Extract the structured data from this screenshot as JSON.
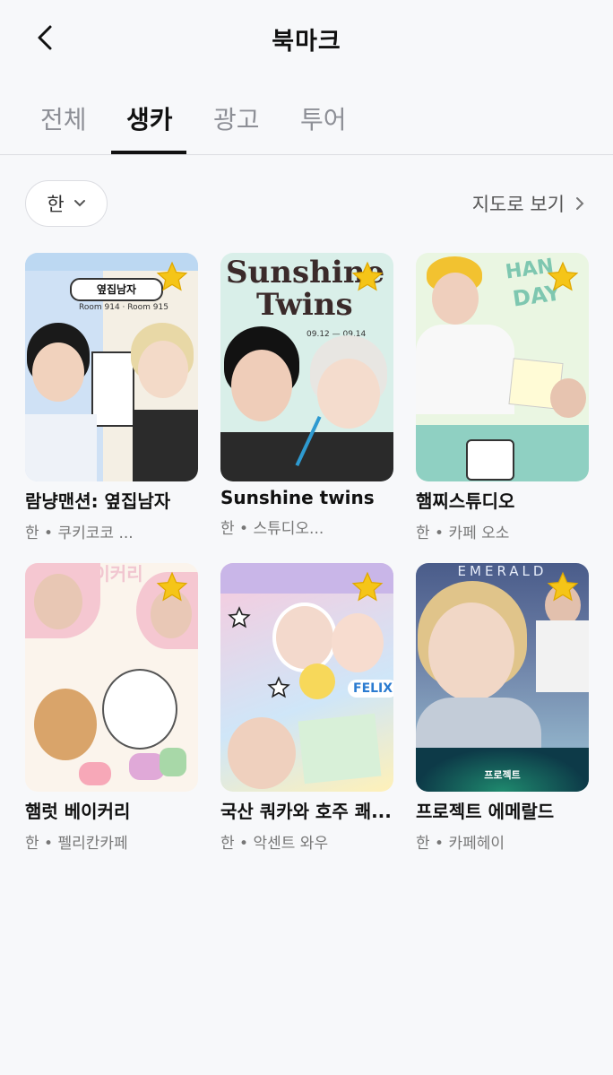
{
  "header": {
    "title": "북마크"
  },
  "tabs": [
    {
      "label": "전체"
    },
    {
      "label": "생카",
      "active": true
    },
    {
      "label": "광고"
    },
    {
      "label": "투어"
    }
  ],
  "filter": {
    "selected": "한"
  },
  "map_link": {
    "label": "지도로 보기"
  },
  "cards": [
    {
      "title": "람냥맨션: 옆집남자",
      "subtitle": "한 • 쿠키코코 ...",
      "art_text": [
        "옆집남자",
        "Room 914 · Room 915"
      ]
    },
    {
      "title": "Sunshine twins",
      "subtitle": "한 • 스튜디오...",
      "art_text": [
        "Sunshine",
        "Twins",
        "09.12 — 09.14"
      ]
    },
    {
      "title": "햄찌스튜디오",
      "subtitle": "한 • 카페 오소",
      "art_text": [
        "HAN",
        "DAY"
      ]
    },
    {
      "title": "햄럿 베이커리",
      "subtitle": "한 • 펠리칸카페",
      "art_text": [
        "베이커리"
      ]
    },
    {
      "title": "국산 쿼카와 호주 쾌...",
      "subtitle": "한 • 악센트 와우",
      "art_text": [
        "FELIX"
      ]
    },
    {
      "title": "프로젝트 에메랄드",
      "subtitle": "한 • 카페헤이",
      "art_text": [
        "EMERALD",
        "프로젝트"
      ]
    }
  ],
  "colors": {
    "star": "#f5c518",
    "active_tab": "#111111",
    "inactive_tab": "#8d8f96"
  }
}
